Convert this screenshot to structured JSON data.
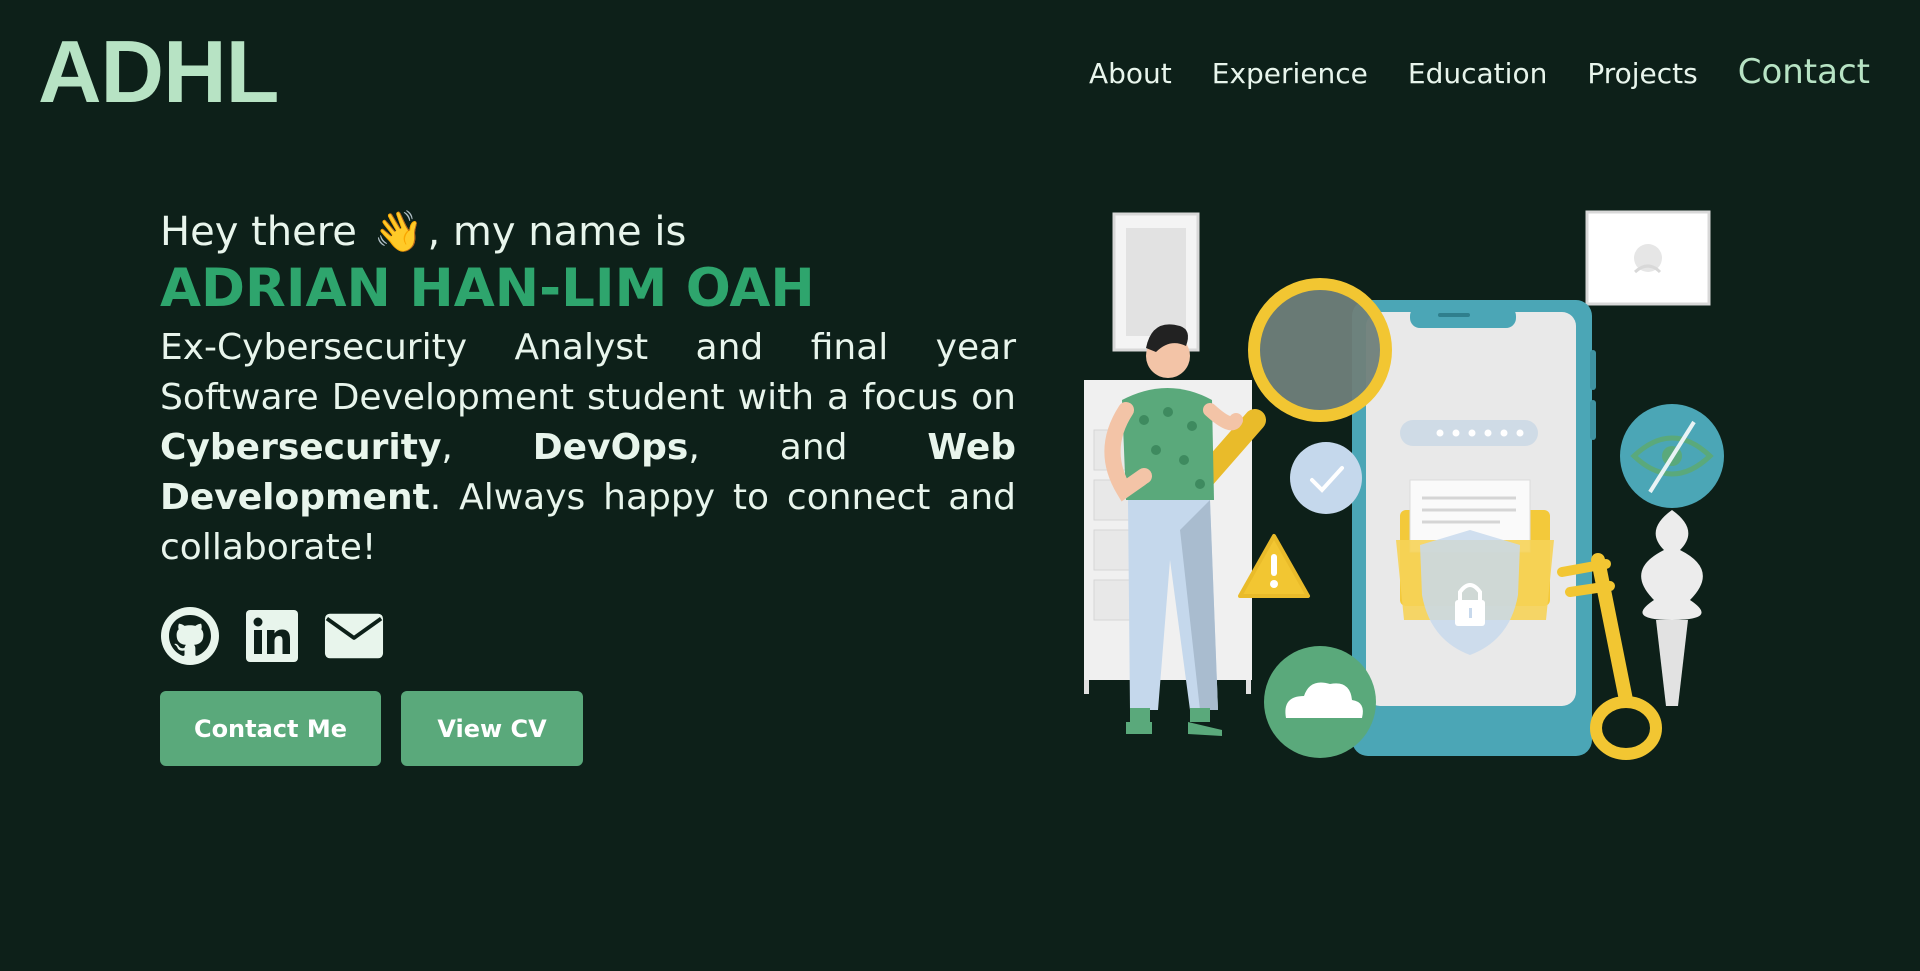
{
  "header": {
    "logo": "ADHL",
    "nav": {
      "about": "About",
      "experience": "Experience",
      "education": "Education",
      "projects": "Projects",
      "contact": "Contact"
    }
  },
  "hero": {
    "greeting_prefix": "Hey there",
    "wave_emoji": "👋",
    "greeting_suffix": ", my name is",
    "name": "ADRIAN HAN-LIM OAH",
    "bio": {
      "part1": "Ex-Cybersecurity Analyst and final year Software Development student with a focus on ",
      "highlight1": "Cybersecurity",
      "part2": ", ",
      "highlight2": "DevOps",
      "part3": ", and ",
      "highlight3": "Web Development",
      "part4": ". Always happy to connect and collaborate!"
    }
  },
  "socials": [
    {
      "icon": "github-icon"
    },
    {
      "icon": "linkedin-icon"
    },
    {
      "icon": "email-icon"
    }
  ],
  "buttons": {
    "contact": "Contact Me",
    "cv": "View CV"
  },
  "colors": {
    "background": "#0d2019",
    "accent": "#2ea56d",
    "logo": "#b7e3c4",
    "button": "#5aa97b",
    "text": "#e8f5ec"
  }
}
